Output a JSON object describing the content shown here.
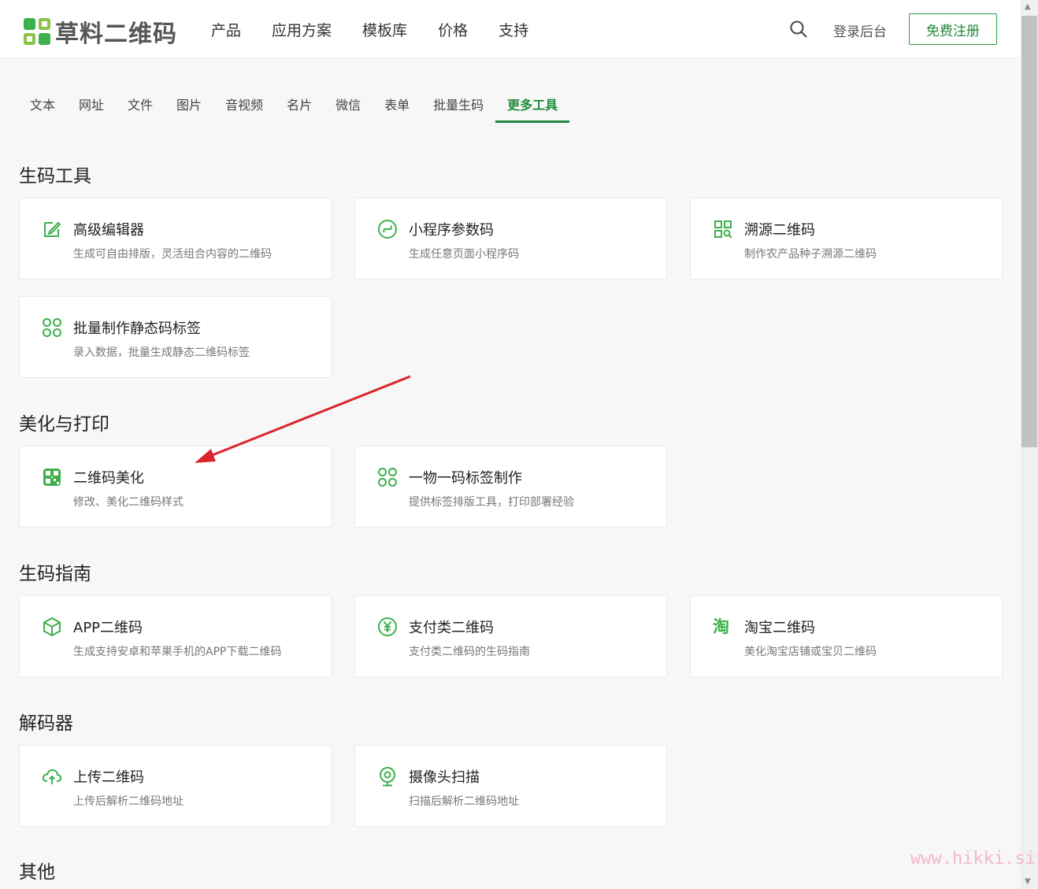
{
  "header": {
    "logo_text": "草料二维码",
    "nav": [
      "产品",
      "应用方案",
      "模板库",
      "价格",
      "支持"
    ],
    "login": "登录后台",
    "register": "免费注册"
  },
  "tabs": [
    "文本",
    "网址",
    "文件",
    "图片",
    "音视频",
    "名片",
    "微信",
    "表单",
    "批量生码",
    "更多工具"
  ],
  "active_tab": "更多工具",
  "sections": {
    "gen": {
      "title": "生码工具",
      "cards": [
        {
          "title": "高级编辑器",
          "desc": "生成可自由排版，灵活组合内容的二维码",
          "icon": "edit-icon"
        },
        {
          "title": "小程序参数码",
          "desc": "生成任意页面小程序码",
          "icon": "mini-program-icon"
        },
        {
          "title": "溯源二维码",
          "desc": "制作农产品种子溯源二维码",
          "icon": "qr-trace-icon"
        },
        {
          "title": "批量制作静态码标签",
          "desc": "录入数据，批量生成静态二维码标签",
          "icon": "grid-clover-icon"
        }
      ]
    },
    "beautify": {
      "title": "美化与打印",
      "cards": [
        {
          "title": "二维码美化",
          "desc": "修改、美化二维码样式",
          "icon": "qr-beautify-icon"
        },
        {
          "title": "一物一码标签制作",
          "desc": "提供标签排版工具，打印部署经验",
          "icon": "grid-clover-icon"
        }
      ]
    },
    "guide": {
      "title": "生码指南",
      "cards": [
        {
          "title": "APP二维码",
          "desc": "生成支持安卓和苹果手机的APP下载二维码",
          "icon": "box-icon"
        },
        {
          "title": "支付类二维码",
          "desc": "支付类二维码的生码指南",
          "icon": "yen-icon"
        },
        {
          "title": "淘宝二维码",
          "desc": "美化淘宝店铺或宝贝二维码",
          "icon": "taobao-icon",
          "icon_text": "淘"
        }
      ]
    },
    "decoder": {
      "title": "解码器",
      "cards": [
        {
          "title": "上传二维码",
          "desc": "上传后解析二维码地址",
          "icon": "cloud-upload-icon"
        },
        {
          "title": "摄像头扫描",
          "desc": "扫描后解析二维码地址",
          "icon": "camera-icon"
        }
      ]
    },
    "other": {
      "title": "其他"
    }
  },
  "watermark": "www.hikki.site",
  "colors": {
    "accent": "#1f8a3a",
    "icon_green": "#3eb04b",
    "arrow": "#d9252b"
  }
}
